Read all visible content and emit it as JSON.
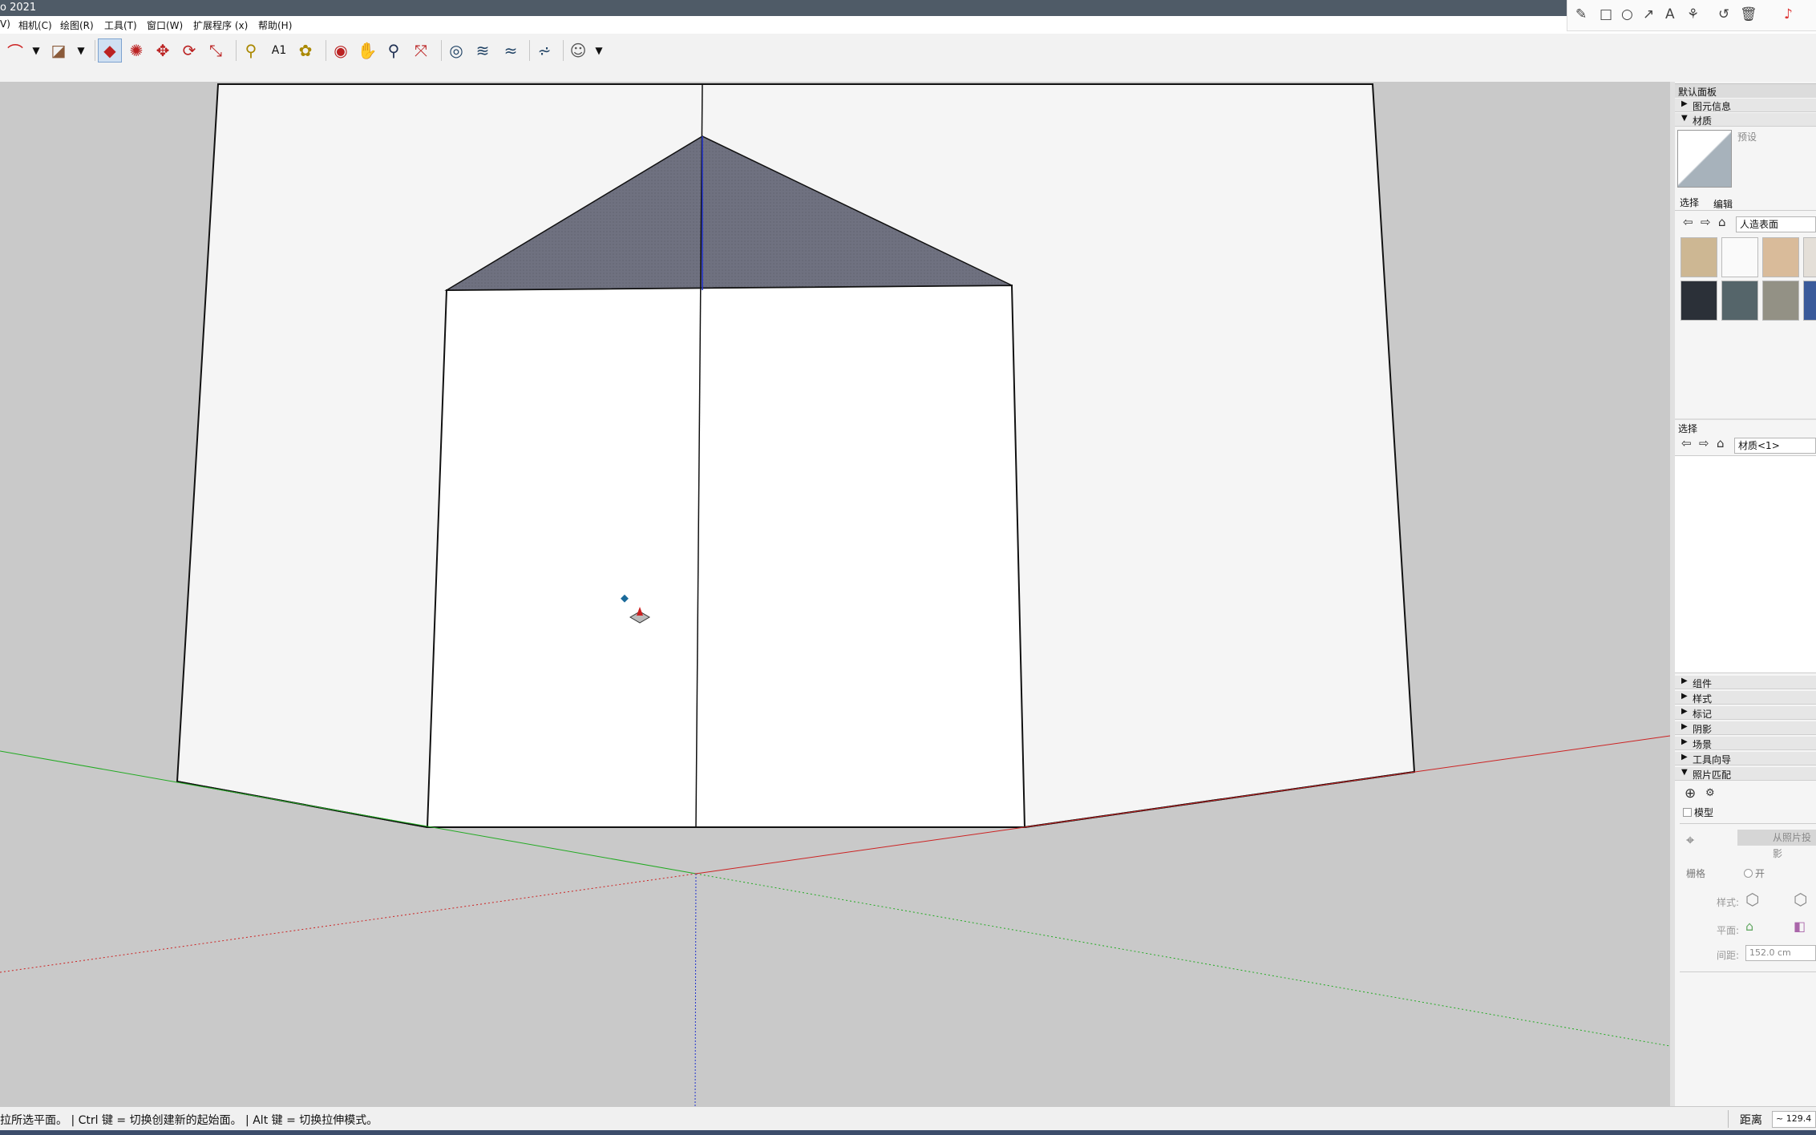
{
  "window": {
    "title": "o 2021"
  },
  "menu": [
    "V)",
    "相机(C)",
    "绘图(R)",
    "工具(T)",
    "窗口(W)",
    "扩展程序 (x)",
    "帮助(H)"
  ],
  "annotation_tools": [
    "pencil-icon",
    "rectangle-icon",
    "circle-icon",
    "arrow-icon",
    "text-icon",
    "magic-wand-icon",
    "undo-icon",
    "trash-icon"
  ],
  "toolbar_icons": [
    "arc-tool-icon",
    "paint-bucket-icon",
    "push-pull-icon",
    "follow-me-icon",
    "move-icon",
    "rotate-icon",
    "scale-icon",
    "tape-measure-icon",
    "text-label-icon",
    "paint-icon",
    "orbit-icon",
    "pan-icon",
    "zoom-icon",
    "zoom-extents-icon",
    "section-plane-icon",
    "layers-icon",
    "component-icon",
    "sandbox-icon",
    "account-icon"
  ],
  "panel": {
    "title": "默认面板",
    "entity_info": "图元信息",
    "materials": "材质",
    "preset_label": "预设",
    "tab_select": "选择",
    "tab_edit": "编辑",
    "material_category": "人造表面",
    "select_label": "选择",
    "model_material": "材质<1>",
    "sections": [
      "组件",
      "样式",
      "标记",
      "阴影",
      "场景",
      "工具向导"
    ],
    "photo_match": "照片匹配",
    "model_checkbox": "模型",
    "from_photo_button": "从照片投影",
    "grid_label": "栅格",
    "grid_on": "开",
    "style_label": "样式:",
    "plane_label": "平面:",
    "spacing_label": "间距:",
    "spacing_value": "152.0 cm"
  },
  "status": {
    "message": "拉所选平面。 | Ctrl 键 = 切换创建新的起始面。 | Alt 键 = 切换拉伸模式。",
    "measure_label": "距离",
    "measure_value": "~ 129.4"
  },
  "colors": {
    "roof": "#6f7180",
    "x_axis": "#cc2222",
    "y_axis": "#22aa22",
    "z_axis": "#2233cc"
  }
}
